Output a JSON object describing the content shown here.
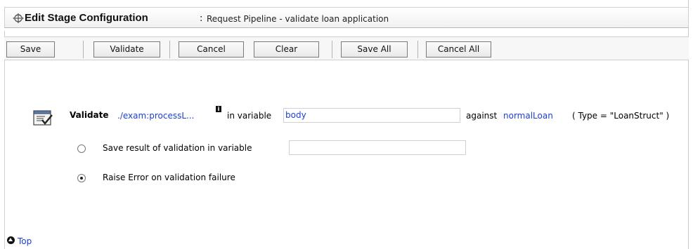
{
  "header": {
    "title": "Edit Stage Configuration",
    "separator": ":",
    "subtitle": "Request Pipeline - validate loan application"
  },
  "toolbar": {
    "save_label": "Save",
    "validate_label": "Validate",
    "cancel_label": "Cancel",
    "clear_label": "Clear",
    "save_all_label": "Save All",
    "cancel_all_label": "Cancel All"
  },
  "validate_row": {
    "label": "Validate",
    "expression": "./exam:processL...",
    "info_icon": "i",
    "in_variable_label": "in variable",
    "variable_value": "body",
    "against_label": "against",
    "against_value": "normalLoan",
    "type_text": "( Type = \"LoanStruct\" )"
  },
  "options": {
    "save_result_label": "Save result of validation in variable",
    "save_result_value": "",
    "raise_error_label": "Raise Error on validation failure",
    "selected": "raise_error"
  },
  "footer": {
    "top_label": "Top"
  },
  "colors": {
    "link": "#1b3fd6",
    "border": "#cfcfcf"
  }
}
